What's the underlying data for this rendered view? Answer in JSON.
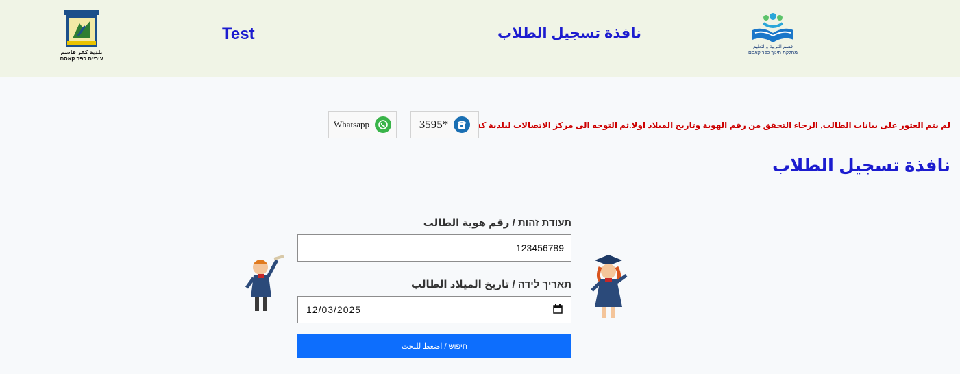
{
  "header": {
    "test_label": "Test",
    "title": "نافذة تسجيل الطلاب",
    "municipality_logo_text_ar": "بلدية كفر قاسم",
    "municipality_logo_text_he": "עיריית כפר קאסם",
    "education_logo_text_ar": "قسم التربية والتعليم",
    "education_logo_text_he": "מחלקת חינוך כפר קאסם"
  },
  "notice": {
    "text": "لم يتم العثور على بيانات الطالب, الرجاء التحقق من رقم الهوية وتاريخ الميلاد اولا.ثم التوجه الى مركز الاتصالات لبلدية كفر قاسم:",
    "color": "#cc0000"
  },
  "contacts": {
    "phone_number": "3595*",
    "whatsapp_label": "Whatsapp"
  },
  "form": {
    "page_title": "نافذة تسجيل الطلاب",
    "id_label": "תעודת זהות / رقم هوية الطالب",
    "id_value": "123456789",
    "dob_label": "תאריך לידה / تاريخ الميلاد الطالب",
    "dob_value": "12/03/2025",
    "search_button_label": "חיפוש / اضغط للبحث"
  },
  "colors": {
    "accent_blue": "#1c1ccf",
    "button_blue": "#0d6efd",
    "header_bg": "#f0f4e6"
  }
}
